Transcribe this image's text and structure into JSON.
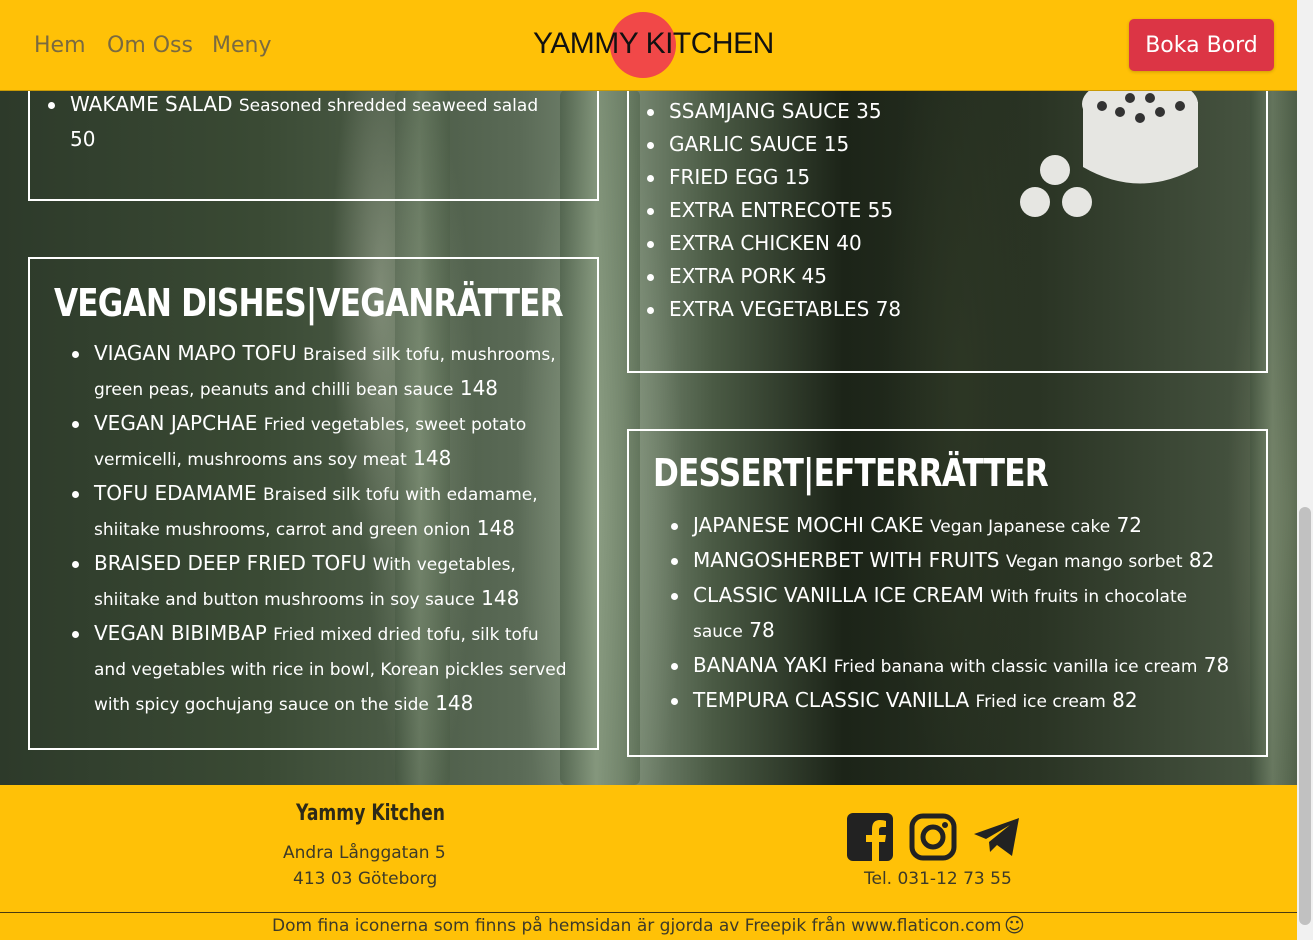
{
  "nav": {
    "links": [
      "Hem",
      "Om Oss",
      "Meny"
    ],
    "logo": "YAMMY KITCHEN",
    "book_button": "Boka Bord"
  },
  "top_left_box": {
    "items": [
      {
        "name": "WAKAME SALAD",
        "desc": "Seasoned shredded seaweed salad",
        "price": "50"
      }
    ]
  },
  "top_right_box": {
    "items": [
      {
        "name": "SSAMJANG SAUCE",
        "price": "35"
      },
      {
        "name": "GARLIC SAUCE",
        "price": "15"
      },
      {
        "name": "FRIED EGG",
        "price": "15"
      },
      {
        "name": "EXTRA ENTRECOTE",
        "price": "55"
      },
      {
        "name": "EXTRA CHICKEN",
        "price": "40"
      },
      {
        "name": "EXTRA PORK",
        "price": "45"
      },
      {
        "name": "EXTRA VEGETABLES",
        "price": "78"
      }
    ]
  },
  "vegan": {
    "title": "VEGAN DISHES|VEGANRÄTTER",
    "items": [
      {
        "name": "VIAGAN MAPO TOFU",
        "desc": "Braised silk tofu, mushrooms, green peas, peanuts and chilli bean sauce",
        "price": "148"
      },
      {
        "name": "VEGAN JAPCHAE",
        "desc": "Fried vegetables, sweet potato vermicelli, mushrooms ans soy meat",
        "price": "148"
      },
      {
        "name": "TOFU EDAMAME",
        "desc": "Braised silk tofu with edamame, shiitake mushrooms, carrot and green onion",
        "price": "148"
      },
      {
        "name": "BRAISED DEEP FRIED TOFU",
        "desc": "With vegetables, shiitake and button mushrooms in soy sauce",
        "price": "148"
      },
      {
        "name": "VEGAN BIBIMBAP",
        "desc": "Fried mixed dried tofu, silk tofu and vegetables with rice in bowl, Korean pickles served with spicy gochujang sauce on the side",
        "price": "148"
      }
    ]
  },
  "dessert": {
    "title": "DESSERT|EFTERRÄTTER",
    "items": [
      {
        "name": "JAPANESE MOCHI CAKE",
        "desc": "Vegan Japanese cake",
        "price": "72"
      },
      {
        "name": "MANGOSHERBET WITH FRUITS",
        "desc": "Vegan mango sorbet",
        "price": "82"
      },
      {
        "name": "CLASSIC VANILLA ICE CREAM",
        "desc": "With fruits in chocolate sauce",
        "price": "78"
      },
      {
        "name": "BANANA YAKI",
        "desc": "Fried banana with classic vanilla ice cream",
        "price": "78"
      },
      {
        "name": "TEMPURA CLASSIC VANILLA",
        "desc": "Fried ice cream",
        "price": "82"
      }
    ]
  },
  "footer": {
    "name": "Yammy Kitchen",
    "address_line1": "Andra Långgatan 5",
    "address_line2": "413 03 Göteborg",
    "phone": "Tel. 031-12 73 55",
    "credit": "Dom fina iconerna som finns på hemsidan är gjorda av Freepik från www.flaticon.com",
    "social": [
      "facebook-icon",
      "instagram-icon",
      "telegram-icon"
    ]
  },
  "colors": {
    "header_bg": "#ffc107",
    "button_bg": "#dc3545",
    "logo_circle": "#f14848"
  }
}
